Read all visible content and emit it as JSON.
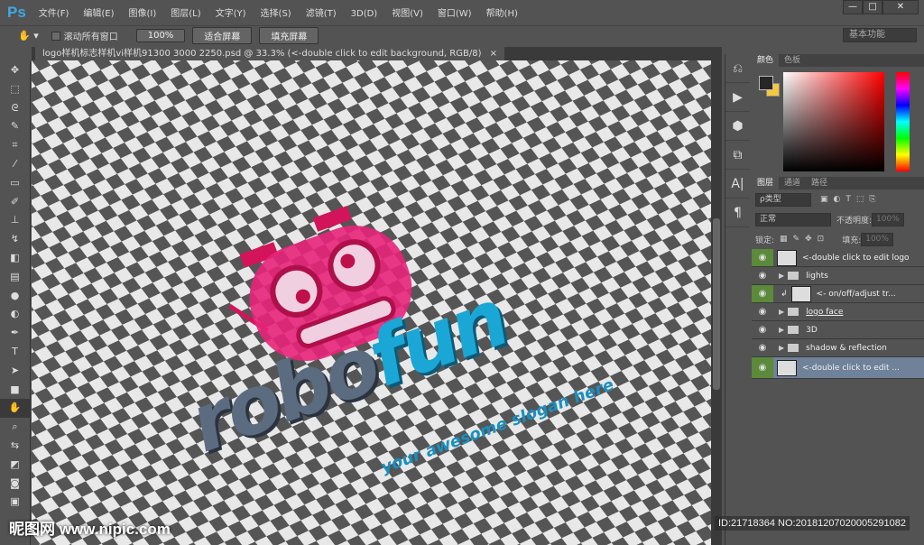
{
  "app": {
    "logo": "Ps",
    "window_buttons": [
      "—",
      "□",
      "✕"
    ]
  },
  "menu": [
    "文件(F)",
    "编辑(E)",
    "图像(I)",
    "图层(L)",
    "文字(Y)",
    "选择(S)",
    "滤镜(T)",
    "3D(D)",
    "视图(V)",
    "窗口(W)",
    "帮助(H)"
  ],
  "options": {
    "scroll_all": "滚动所有窗口",
    "zoom100": "100%",
    "fit_screen": "适合屏幕",
    "fill_screen": "填充屏幕",
    "workspace": "基本功能"
  },
  "document": {
    "tab": "logo样机标志样机vi样机91300 3000 2250.psd @ 33.3% (<-double click to edit background, RGB/8)",
    "close": "×"
  },
  "artwork": {
    "word1": "robo",
    "word2": "fun",
    "slogan": "your awesome slogan here"
  },
  "color_panel": {
    "tabs": [
      "颜色",
      "色板"
    ],
    "foreground": "#262626",
    "background": "#f5c83c"
  },
  "layers_panel": {
    "tabs": [
      "图层",
      "通道",
      "路径"
    ],
    "filter": "ρ类型",
    "blend_mode": "正常",
    "opacity_label": "不透明度:",
    "opacity": "100%",
    "lock_label": "锁定:",
    "fill_label": "填充:",
    "fill": "100%",
    "layers": [
      {
        "name": "<-double click to edit logo",
        "type": "smart"
      },
      {
        "name": "lights",
        "type": "group"
      },
      {
        "name": "<- on/off/adjust tr...",
        "type": "smart"
      },
      {
        "name": "logo face",
        "type": "group"
      },
      {
        "name": "3D",
        "type": "group"
      },
      {
        "name": "shadow & reflection",
        "type": "group"
      },
      {
        "name": "<-double click to edit ...",
        "type": "smart",
        "selected": true
      }
    ]
  },
  "watermark": {
    "site": "昵图网 www.nipic.com",
    "id": "ID:21718364 NO:20181207020005291082"
  }
}
